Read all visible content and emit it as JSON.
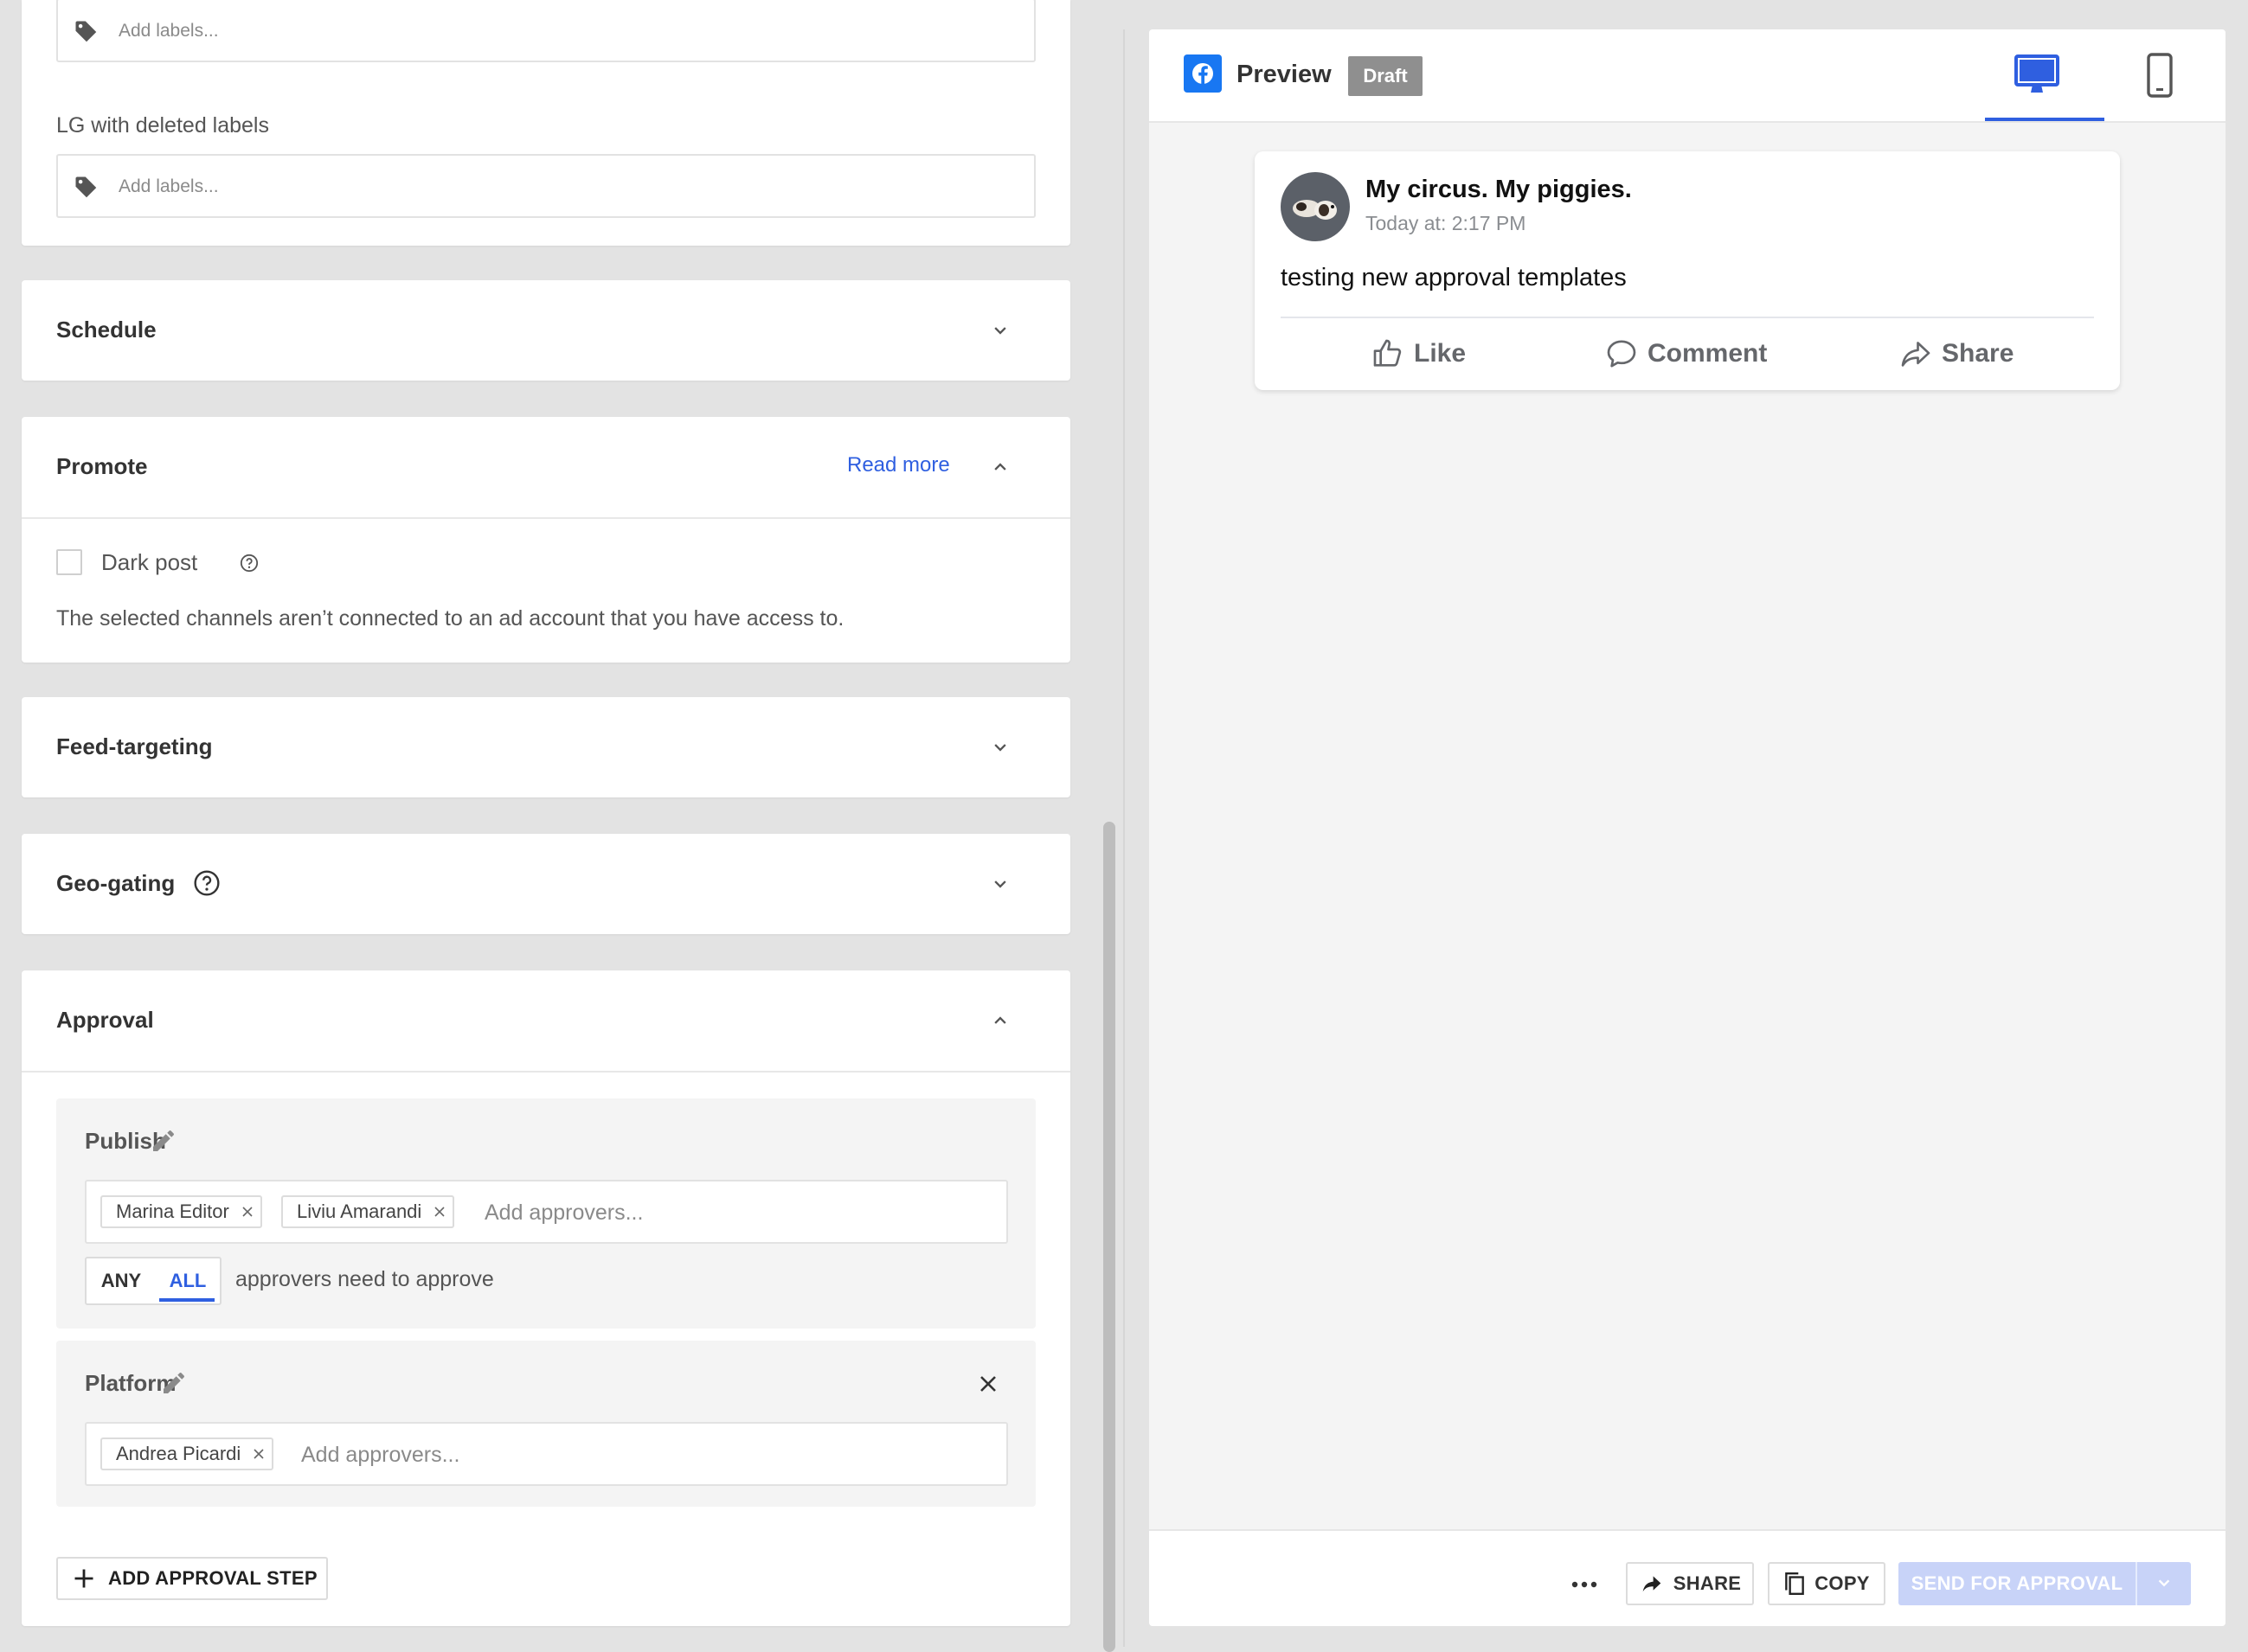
{
  "labels_section": {
    "first_input_placeholder": "Add labels...",
    "deleted_labels_title": "LG with deleted labels",
    "second_input_placeholder": "Add labels..."
  },
  "schedule": {
    "title": "Schedule",
    "expanded": false
  },
  "promote": {
    "title": "Promote",
    "read_more": "Read more",
    "expanded": true,
    "dark_post_label": "Dark post",
    "dark_post_checked": false,
    "notice": "The selected channels aren’t connected to an ad account that you have access to."
  },
  "feed_targeting": {
    "title": "Feed-targeting",
    "expanded": false
  },
  "geo_gating": {
    "title": "Geo-gating",
    "expanded": false
  },
  "approval": {
    "title": "Approval",
    "expanded": true,
    "steps": [
      {
        "title": "Publish",
        "approvers": [
          "Marina Editor",
          "Liviu Amarandi"
        ],
        "placeholder": "Add approvers...",
        "mode_options": [
          "ANY",
          "ALL"
        ],
        "mode_selected": "ALL",
        "mode_text": "approvers need to approve"
      },
      {
        "title": "Platform",
        "approvers": [
          "Andrea Picardi"
        ],
        "placeholder": "Add approvers..."
      }
    ],
    "add_step_label": "ADD APPROVAL STEP"
  },
  "preview": {
    "title": "Preview",
    "status_badge": "Draft",
    "active_view": "desktop",
    "post": {
      "page_name": "My circus. My piggies.",
      "timestamp": "Today at: 2:17 PM",
      "text": "testing new approval templates",
      "actions": [
        "Like",
        "Comment",
        "Share"
      ]
    }
  },
  "footer": {
    "share_label": "SHARE",
    "copy_label": "COPY",
    "send_label": "SEND FOR APPROVAL"
  },
  "colors": {
    "accent": "#2f5fe0",
    "facebook": "#1877f2",
    "badge": "#8f8f8f",
    "send_disabled": "#c8d3f8"
  }
}
